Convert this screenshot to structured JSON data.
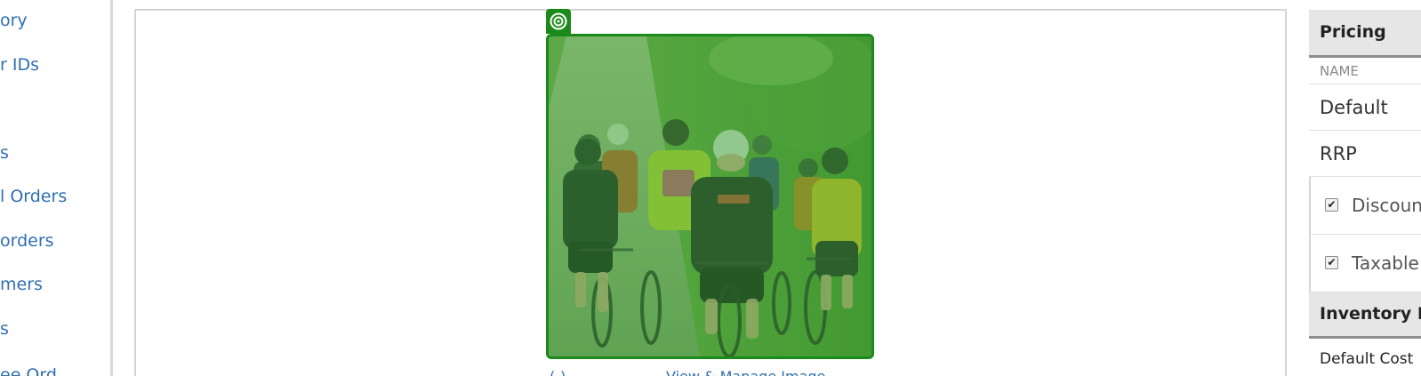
{
  "sidebar": {
    "items": [
      {
        "label": "ory"
      },
      {
        "label": "r IDs"
      },
      {
        "label": "s"
      },
      {
        "label": "l Orders"
      },
      {
        "label": "orders"
      },
      {
        "label": "mers"
      },
      {
        "label": "s"
      },
      {
        "label": "ee Ord"
      }
    ]
  },
  "image_panel": {
    "main_image_alt": "Group of cyclists riding on a country road",
    "below_left": "(-)",
    "below_link": "View & Manage Image",
    "highlight_color": "#1b8a1b"
  },
  "pricing": {
    "header": "Pricing",
    "name_col": "NAME",
    "rows": [
      {
        "label": "Default"
      },
      {
        "label": "RRP"
      }
    ],
    "checkboxes": [
      {
        "label": "Discoun",
        "checked": true
      },
      {
        "label": "Taxable",
        "checked": true
      }
    ]
  },
  "inventory": {
    "header": "Inventory D",
    "first_row": "Default Cost"
  },
  "colors": {
    "link": "#2f6fb1",
    "header_bg": "#e6e6e6",
    "accent_green": "#1b8a1b"
  }
}
